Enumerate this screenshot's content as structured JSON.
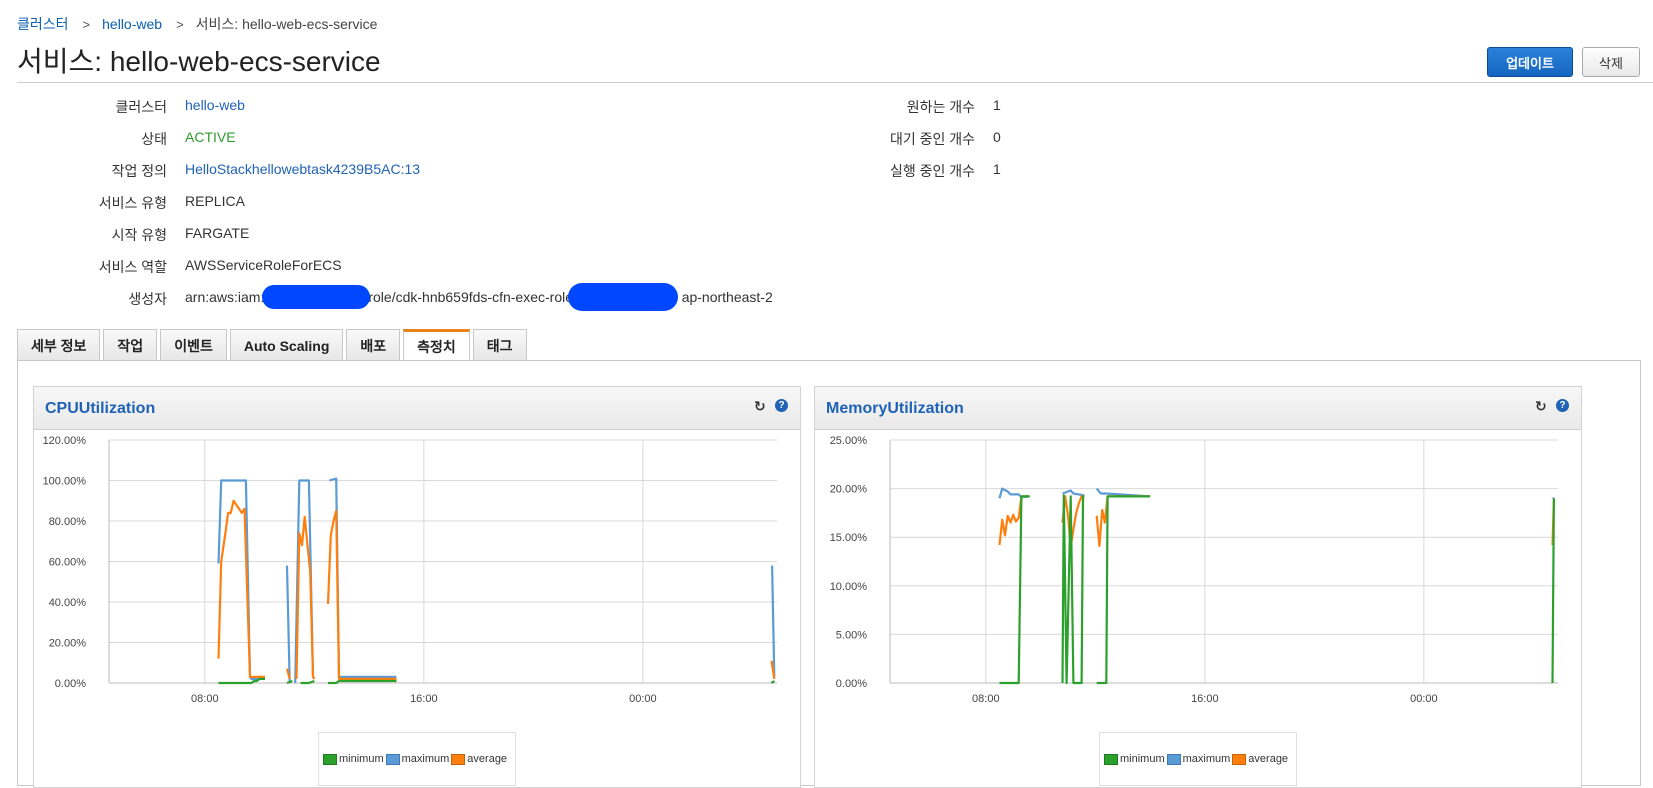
{
  "breadcrumb": {
    "cluster": "클러스터",
    "cluster_name": "hello-web",
    "service": "서비스: hello-web-ecs-service"
  },
  "page": {
    "title": "서비스: hello-web-ecs-service"
  },
  "buttons": {
    "update": "업데이트",
    "delete": "삭제"
  },
  "details": {
    "cluster_label": "클러스터",
    "cluster_value": "hello-web",
    "status_label": "상태",
    "status_value": "ACTIVE",
    "taskdef_label": "작업 정의",
    "taskdef_value": "HelloStackhellowebtask4239B5AC:13",
    "svctype_label": "서비스 유형",
    "svctype_value": "REPLICA",
    "launch_label": "시작 유형",
    "launch_value": "FARGATE",
    "role_label": "서비스 역할",
    "role_value": "AWSServiceRoleForECS",
    "creator_label": "생성자",
    "creator_part1": "arn:aws:iam:",
    "creator_part2": "role/cdk-hnb659fds-cfn-exec-role-",
    "creator_part3": "ap-northeast-2",
    "desired_label": "원하는 개수",
    "desired_value": "1",
    "pending_label": "대기 중인 개수",
    "pending_value": "0",
    "running_label": "실행 중인 개수",
    "running_value": "1"
  },
  "tabs": [
    "세부 정보",
    "작업",
    "이벤트",
    "Auto Scaling",
    "배포",
    "측정치",
    "태그"
  ],
  "active_tab": "측정치",
  "colors": {
    "minimum": "#2ca02c",
    "maximum": "#5b9bd5",
    "average": "#ff7f0e"
  },
  "chart_data": [
    {
      "type": "line",
      "title": "CPUUtilization",
      "ylim": [
        0,
        120
      ],
      "yticks": [
        0,
        20,
        40,
        60,
        80,
        100,
        120
      ],
      "ytick_labels": [
        "0.00%",
        "20.00%",
        "40.00%",
        "60.00%",
        "80.00%",
        "100.00%",
        "120.00%"
      ],
      "xticks": [
        8,
        16,
        24
      ],
      "xtick_labels": [
        "08:00",
        "16:00",
        "00:00"
      ],
      "xlim": [
        4.5,
        28.9
      ],
      "grid": true,
      "legend": "bottom",
      "series": [
        {
          "name": "minimum",
          "segments": [
            [
              [
                8.5,
                0
              ],
              [
                9.7,
                0
              ],
              [
                9.8,
                1
              ],
              [
                9.9,
                1
              ],
              [
                10.0,
                2
              ],
              [
                10.2,
                2
              ]
            ],
            [
              [
                11.0,
                0
              ],
              [
                11.2,
                1
              ]
            ],
            [
              [
                11.5,
                0
              ],
              [
                11.8,
                0
              ],
              [
                12.0,
                1
              ]
            ],
            [
              [
                12.5,
                0
              ],
              [
                12.8,
                0
              ],
              [
                12.9,
                1
              ],
              [
                13.2,
                1
              ],
              [
                15.0,
                1
              ]
            ],
            [
              [
                28.7,
                0
              ],
              [
                28.8,
                1
              ]
            ]
          ]
        },
        {
          "name": "maximum",
          "segments": [
            [
              [
                8.5,
                59
              ],
              [
                8.6,
                100
              ],
              [
                9.1,
                100
              ],
              [
                9.2,
                100
              ],
              [
                9.4,
                100
              ],
              [
                9.5,
                100
              ],
              [
                9.65,
                3
              ],
              [
                9.7,
                2
              ],
              [
                10.2,
                2
              ]
            ],
            [
              [
                11.0,
                58
              ],
              [
                11.1,
                0
              ]
            ],
            [
              [
                11.3,
                0
              ],
              [
                11.45,
                100
              ],
              [
                11.8,
                100
              ],
              [
                11.95,
                3
              ],
              [
                12.0,
                2
              ]
            ],
            [
              [
                12.55,
                100
              ],
              [
                12.8,
                101
              ],
              [
                12.9,
                3
              ],
              [
                13.2,
                3
              ],
              [
                15.0,
                3
              ]
            ],
            [
              [
                28.72,
                58
              ],
              [
                28.8,
                3
              ]
            ]
          ]
        },
        {
          "name": "average",
          "segments": [
            [
              [
                8.5,
                12
              ],
              [
                8.6,
                60
              ],
              [
                8.75,
                74
              ],
              [
                8.85,
                84
              ],
              [
                8.95,
                84
              ],
              [
                9.05,
                90
              ],
              [
                9.15,
                88
              ],
              [
                9.25,
                86
              ],
              [
                9.35,
                84
              ],
              [
                9.45,
                86
              ],
              [
                9.65,
                3
              ],
              [
                10.2,
                3
              ]
            ],
            [
              [
                11.0,
                7
              ],
              [
                11.1,
                2
              ]
            ],
            [
              [
                11.35,
                2
              ],
              [
                11.45,
                74
              ],
              [
                11.55,
                68
              ],
              [
                11.65,
                82
              ],
              [
                11.75,
                68
              ],
              [
                11.85,
                55
              ],
              [
                11.95,
                3
              ],
              [
                12.0,
                2
              ]
            ],
            [
              [
                12.5,
                39
              ],
              [
                12.6,
                73
              ],
              [
                12.7,
                80
              ],
              [
                12.8,
                85
              ],
              [
                12.9,
                2
              ],
              [
                13.2,
                2
              ],
              [
                15.0,
                2
              ]
            ],
            [
              [
                28.7,
                11
              ],
              [
                28.8,
                2
              ]
            ]
          ]
        }
      ]
    },
    {
      "type": "line",
      "title": "MemoryUtilization",
      "ylim": [
        0,
        25
      ],
      "yticks": [
        0,
        5,
        10,
        15,
        20,
        25
      ],
      "ytick_labels": [
        "0.00%",
        "5.00%",
        "10.00%",
        "15.00%",
        "20.00%",
        "25.00%"
      ],
      "xticks": [
        8,
        16,
        24
      ],
      "xtick_labels": [
        "08:00",
        "16:00",
        "00:00"
      ],
      "xlim": [
        4.5,
        28.9
      ],
      "grid": true,
      "legend": "bottom",
      "series": [
        {
          "name": "minimum",
          "segments": [
            [
              [
                8.5,
                0
              ],
              [
                9.2,
                0
              ],
              [
                9.3,
                19.2
              ],
              [
                9.6,
                19.2
              ]
            ],
            [
              [
                10.8,
                0
              ],
              [
                10.85,
                19.3
              ],
              [
                10.95,
                0
              ],
              [
                11.1,
                19.2
              ],
              [
                11.2,
                0
              ],
              [
                11.5,
                0
              ],
              [
                11.55,
                19.2
              ],
              [
                11.6,
                19.2
              ]
            ],
            [
              [
                12.05,
                0
              ],
              [
                12.4,
                0
              ],
              [
                12.45,
                19.2
              ],
              [
                14.0,
                19.2
              ]
            ],
            [
              [
                28.7,
                0
              ],
              [
                28.75,
                19
              ]
            ]
          ]
        },
        {
          "name": "maximum",
          "segments": [
            [
              [
                8.5,
                19
              ],
              [
                8.6,
                20
              ],
              [
                8.8,
                19.7
              ],
              [
                8.9,
                19.4
              ],
              [
                9.2,
                19.4
              ],
              [
                9.3,
                19.1
              ],
              [
                9.6,
                19.2
              ]
            ],
            [
              [
                10.8,
                19.5
              ],
              [
                11.1,
                19.8
              ],
              [
                11.2,
                19.5
              ],
              [
                11.6,
                19.3
              ]
            ],
            [
              [
                12.05,
                20
              ],
              [
                12.2,
                19.5
              ],
              [
                12.4,
                19.5
              ],
              [
                14.0,
                19.2
              ]
            ],
            [
              [
                28.7,
                19
              ],
              [
                28.75,
                19
              ]
            ]
          ]
        },
        {
          "name": "average",
          "segments": [
            [
              [
                8.5,
                14.2
              ],
              [
                8.6,
                16.8
              ],
              [
                8.7,
                15.2
              ],
              [
                8.8,
                17.2
              ],
              [
                8.9,
                16.5
              ],
              [
                9.0,
                17.3
              ],
              [
                9.1,
                16.6
              ],
              [
                9.2,
                17
              ],
              [
                9.3,
                19.2
              ],
              [
                9.6,
                19.2
              ]
            ],
            [
              [
                10.8,
                16.5
              ],
              [
                10.9,
                19.2
              ],
              [
                11.0,
                17.2
              ],
              [
                11.1,
                14
              ],
              [
                11.2,
                15.8
              ],
              [
                11.3,
                17.5
              ],
              [
                11.4,
                18.5
              ],
              [
                11.5,
                19.2
              ],
              [
                11.6,
                19.2
              ]
            ],
            [
              [
                12.05,
                17.2
              ],
              [
                12.15,
                14.1
              ],
              [
                12.25,
                17.8
              ],
              [
                12.35,
                16.5
              ],
              [
                12.45,
                19.2
              ],
              [
                14.0,
                19.2
              ]
            ],
            [
              [
                28.7,
                14.2
              ],
              [
                28.75,
                18.8
              ]
            ]
          ]
        }
      ]
    }
  ]
}
